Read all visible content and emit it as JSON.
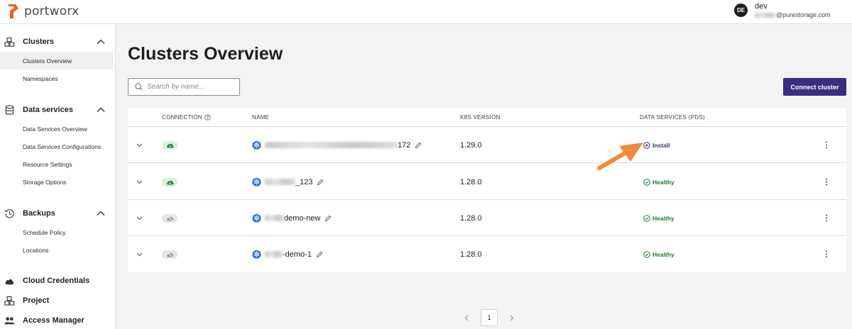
{
  "header": {
    "logo_text": "portworx",
    "user": {
      "initials": "DE",
      "name": "dev",
      "email_suffix": "@purestorage.com"
    }
  },
  "sidebar": {
    "sections": [
      {
        "label": "Clusters",
        "icon": "cubes-icon",
        "items": [
          "Clusters Overview",
          "Namespaces"
        ]
      },
      {
        "label": "Data services",
        "icon": "database-icon",
        "items": [
          "Data Services Overview",
          "Data Services Configurations",
          "Resource Settings",
          "Storage Options"
        ]
      },
      {
        "label": "Backups",
        "icon": "history-icon",
        "items": [
          "Schedule Policy",
          "Locations"
        ]
      }
    ],
    "links": [
      {
        "label": "Cloud Credentials",
        "icon": "cloud-icon"
      },
      {
        "label": "Project",
        "icon": "cubes-icon"
      },
      {
        "label": "Access Manager",
        "icon": "users-icon"
      }
    ],
    "active_item": "Clusters Overview"
  },
  "main": {
    "title": "Clusters Overview",
    "search_placeholder": "Search by name...",
    "connect_button": "Connect cluster",
    "table": {
      "columns": {
        "connection": "CONNECTION",
        "name": "NAME",
        "k8s_version": "K8S VERSION",
        "data_services": "DATA SERVICES (PDS)"
      },
      "rows": [
        {
          "name_suffix": "172",
          "k8s_version": "1.29.0",
          "connected": true,
          "data_services": "Install"
        },
        {
          "name_suffix": "_123",
          "k8s_version": "1.28.0",
          "connected": true,
          "data_services": "Healthy"
        },
        {
          "name_suffix": "demo-new",
          "k8s_version": "1.28.0",
          "connected": false,
          "data_services": "Healthy"
        },
        {
          "name_suffix": "-demo-1",
          "k8s_version": "1.28.0",
          "connected": false,
          "data_services": "Healthy"
        }
      ]
    },
    "pagination": {
      "current_page": "1"
    }
  },
  "colors": {
    "primary": "#3b2c7e",
    "healthy": "#1e7a3a",
    "connected_bg": "#d6f2dc",
    "annotation_arrow": "#f08a3c"
  }
}
